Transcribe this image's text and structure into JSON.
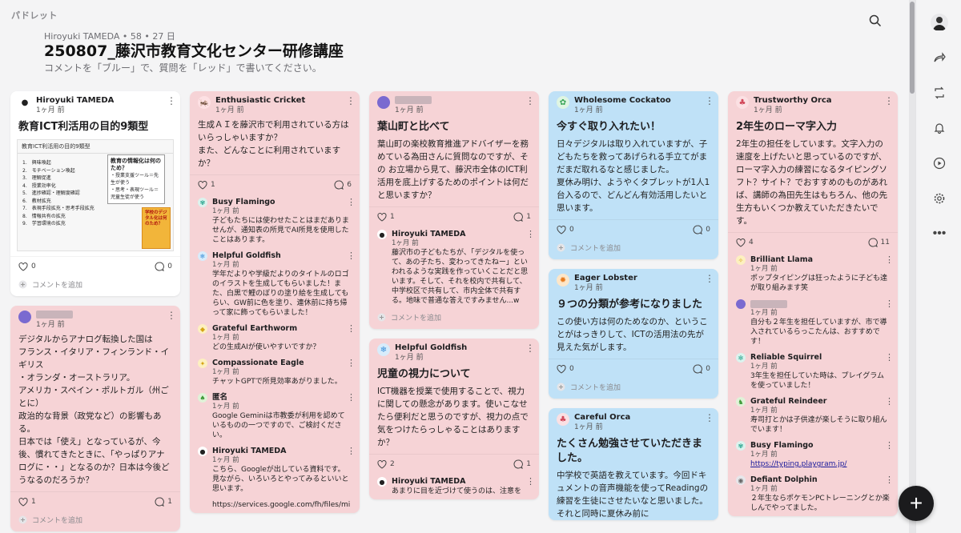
{
  "app": {
    "logo": "パドレット"
  },
  "header": {
    "meta": "Hiroyuki TAMEDA • 58 • 27 日",
    "title": "250807_藤沢市教育文化センター研修講座",
    "subtitle": "コメントを「ブルー」で、質問を「レッド」で書いてください。"
  },
  "add_comment": "コメントを追加",
  "columns": [
    {
      "cards": [
        {
          "color": "white",
          "author": "Hiroyuki TAMEDA",
          "time": "1ヶ月 前",
          "avatar_icon": "person-photo-icon",
          "title": "教育ICT利活用の目的9類型",
          "image": {
            "heading": "教育ICT利活用の目的9類型",
            "list": [
              "1.　興味喚起",
              "2.　モチベーション喚起",
              "3.　理解促進",
              "4.　授業効率化",
              "5.　進捗確認・理解度確認",
              "6.　教材拡充",
              "7.　表現手段拡充・思考手段拡充",
              "8.　情報共有の拡充",
              "9.　学習環境の拡充"
            ],
            "box_title": "教育の情報化は何のため？",
            "box_items": [
              "・授業支援ツール＝先生が使う",
              "・思考・表現ツール＝児童生徒が使う"
            ],
            "book": "学校のデジタル化は何のため？"
          },
          "likes": "0",
          "comments": "0"
        },
        {
          "color": "pink",
          "author": "",
          "time": "1ヶ月 前",
          "avatar_icon": "blurred-avatar-icon",
          "body": "デジタルからアナログ転換した国は\nフランス・イタリア・フィンランド・イギリス\n・オランダ・オーストラリア。\nアメリカ・スペイン・ポルトガル（州ごとに）\n政治的な背景（政党など）の影響もある。\n日本では「使え」となっているが、今後、慣れてきたときに、「やっぱりアナログに・・」となるのか？日本は今後どうなるのだろうか？",
          "likes": "1",
          "comments": "1"
        }
      ]
    },
    {
      "cards": [
        {
          "color": "pink",
          "author": "Enthusiastic Cricket",
          "time": "1ヶ月 前",
          "avatar_icon": "cricket-icon",
          "body": "生成ＡＩを藤沢市で利用されている方はいらっしゃいますか？\nまた、どんなことに利用されていますか？",
          "likes": "1",
          "comments": "6",
          "replies": [
            {
              "author": "Busy Flamingo",
              "time": "1ヶ月 前",
              "icon": "flamingo-icon",
              "text": "子どもたちには使わせたことはまだありませんが、通知表の所見でAI所見を使用したことはあります。"
            },
            {
              "author": "Helpful Goldfish",
              "time": "1ヶ月 前",
              "icon": "goldfish-icon",
              "text": "学年だよりや学級だよりのタイトルのロゴのイラストを生成してもらいました！また、白黒で鯉のぼりの塗り絵を生成してもらい、GW前に色を塗り、連休前に持ち帰って家に飾ってもらいました！"
            },
            {
              "author": "Grateful Earthworm",
              "time": "1ヶ月 前",
              "icon": "earthworm-icon",
              "text": "どの生成AIが使いやすいですか？"
            },
            {
              "author": "Compassionate Eagle",
              "time": "1ヶ月 前",
              "icon": "eagle-icon",
              "text": "チャットGPTで所見効率あがりました。"
            },
            {
              "author": "匿名",
              "time": "1ヶ月 前",
              "icon": "anonymous-icon",
              "text": "Google Geminiは市教委が利用を認めているものの一つですので、ご検討ください。"
            },
            {
              "author": "Hiroyuki TAMEDA",
              "time": "1ヶ月 前",
              "icon": "person-photo-icon",
              "text": "こちら、Googleが出している資料です。見ながら、いろいろとやってみるといいと思います。"
            },
            {
              "author": "",
              "time": "",
              "icon": "",
              "text": "https://services.google.com/fh/files/mi"
            }
          ]
        }
      ]
    },
    {
      "cards": [
        {
          "color": "pink",
          "author": "",
          "time": "1ヶ月 前",
          "avatar_icon": "blurred-avatar-icon",
          "title": "葉山町と比べて",
          "body": "葉山町の楽校教育推進アドバイザーを務めている為田さんに質問なのですが、その お立場から見て、藤沢市全体のICT利活用を底上げするためのポイントは何だと思いますか？",
          "likes": "1",
          "comments": "1",
          "replies": [
            {
              "author": "Hiroyuki TAMEDA",
              "time": "1ヶ月 前",
              "icon": "person-photo-icon",
              "text": "藤沢市の子どもたちが、「デジタルを使って、あの子たち、変わってきたねー」といわれるような実践を作っていくことだと思います。そして、それを校内で共有して、中学校区で共有して、市内全体で共有する。地味で普通な答えですみません...w"
            }
          ]
        },
        {
          "color": "pink",
          "author": "Helpful Goldfish",
          "time": "1ヶ月 前",
          "avatar_icon": "goldfish-icon",
          "title": "児童の視力について",
          "body": "ICT機器を授業で使用することで、視力に関しての懸念があります。使いこなせたら便利だと思うのですが、視力の点で気をつけたらっしゃることはありますか？",
          "likes": "2",
          "comments": "1",
          "replies": [
            {
              "author": "Hiroyuki TAMEDA",
              "time": "",
              "icon": "person-photo-icon",
              "text": "あまりに目を近づけて使うのは、注意を"
            }
          ]
        }
      ]
    },
    {
      "cards": [
        {
          "color": "blue",
          "author": "Wholesome Cockatoo",
          "time": "1ヶ月 前",
          "avatar_icon": "cockatoo-icon",
          "title": "今すぐ取り入れたい！",
          "body": "日々デジタルは取り入れていますが、子どもたちを救ってあげられる手立てがまだまだ取れるなと感じました。\n夏休み明け、ようやくタブレットが1人1台入るので、どんどん有効活用したいと思います。",
          "likes": "0",
          "comments": "0"
        },
        {
          "color": "blue",
          "author": "Eager Lobster",
          "time": "1ヶ月 前",
          "avatar_icon": "lobster-icon",
          "title": "９つの分類が参考になりました",
          "body": "この使い方は何のためなのか、ということがはっきりして、ICTの活用法の先が見えた気がします。",
          "likes": "0",
          "comments": "0"
        },
        {
          "color": "blue",
          "author": "Careful Orca",
          "time": "1ヶ月 前",
          "avatar_icon": "orca-icon",
          "title": "たくさん勉強させていただきました。",
          "body": "中学校で英語を教えています。今回ドキュメントの音声機能を使ってReadingの練習を生徒にさせたいなと思いました。それと同時に夏休み前に"
        }
      ]
    },
    {
      "cards": [
        {
          "color": "pink",
          "author": "Trustworthy Orca",
          "time": "1ヶ月 前",
          "avatar_icon": "orca-icon",
          "title": "2年生のローマ字入力",
          "body": "2年生の担任をしています。文字入力の速度を上げたいと思っているのですが、ローマ字入力の練習になるタイピングソフト？サイト？でおすすめのものがあれば、講師の為田先生はもちろん、他の先生方もいくつか教えていただきたいです。",
          "likes": "4",
          "comments": "11",
          "replies": [
            {
              "author": "Brilliant Llama",
              "time": "1ヶ月 前",
              "icon": "llama-icon",
              "text": "ポップタイピングは狂ったように子ども達が取り組みます笑"
            },
            {
              "author": "",
              "time": "1ヶ月 前",
              "icon": "blurred-avatar-icon",
              "text": "自分も２年生を担任していますが、市で導入されているらっこたんは、おすすめです！"
            },
            {
              "author": "Reliable Squirrel",
              "time": "1ヶ月 前",
              "icon": "squirrel-icon",
              "text": "3年生を担任していた時は、プレイグラムを使っていました！"
            },
            {
              "author": "Grateful Reindeer",
              "time": "1ヶ月 前",
              "icon": "reindeer-icon",
              "text": "寿司打とかは子供達が楽しそうに取り組んでいます！"
            },
            {
              "author": "Busy Flamingo",
              "time": "1ヶ月 前",
              "icon": "flamingo-icon",
              "text": "https://typing.playgram.jp/",
              "link": true
            },
            {
              "author": "Defiant Dolphin",
              "time": "1ヶ月 前",
              "icon": "dolphin-icon",
              "text": "２年生ならポケモンPCトレーニングとか楽しんでやってました。"
            }
          ]
        }
      ]
    }
  ]
}
